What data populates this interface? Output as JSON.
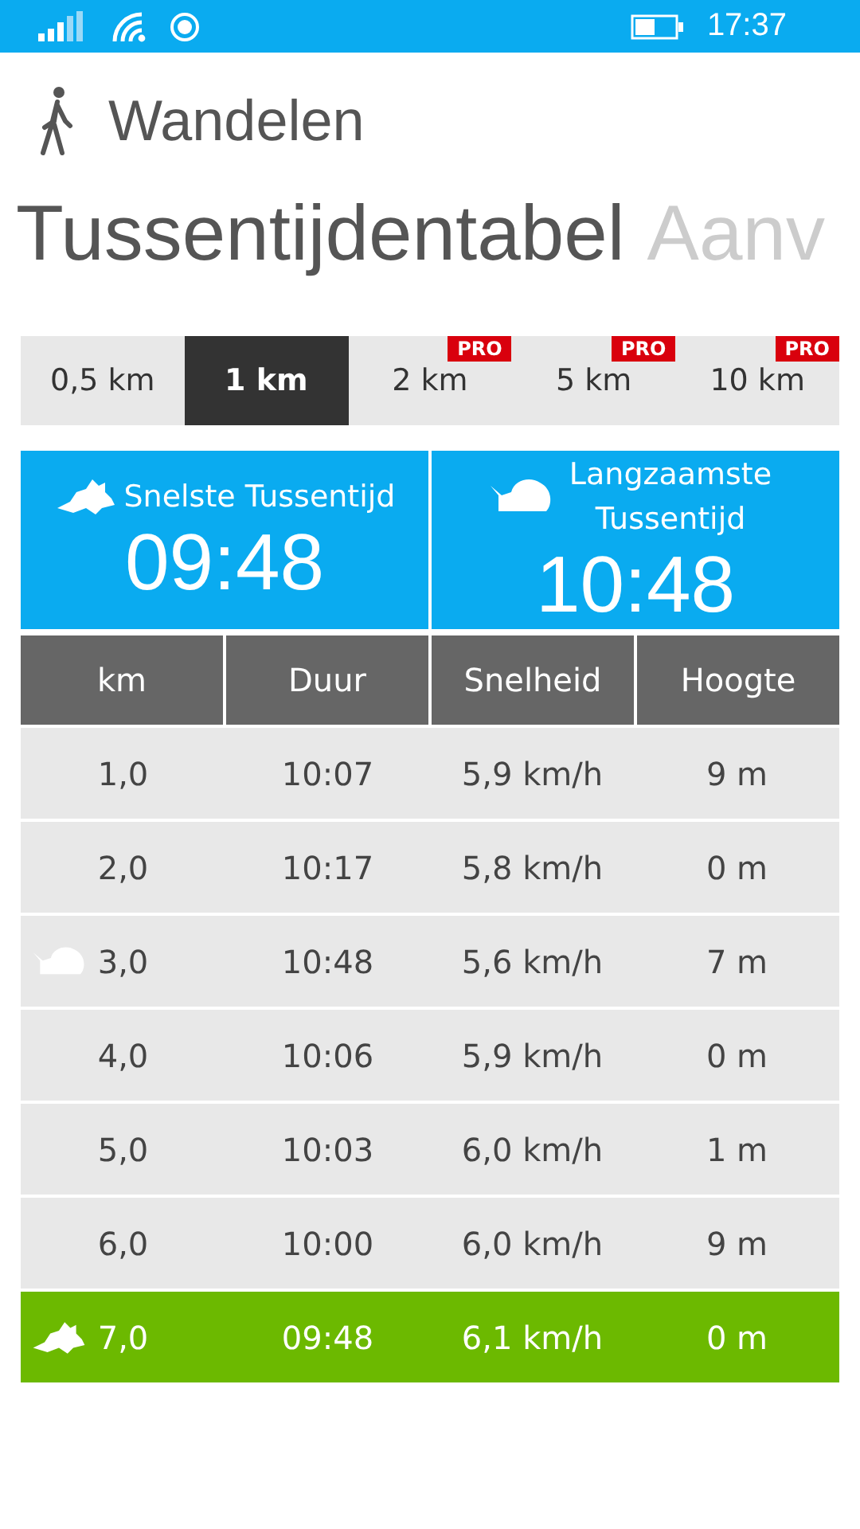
{
  "status_bar": {
    "time": "17:37"
  },
  "app": {
    "title": "Wandelen"
  },
  "pivot": [
    {
      "label": "Tussentijdentabel",
      "selected": true
    },
    {
      "label": "Aanv",
      "selected": false
    }
  ],
  "tabs": [
    {
      "label": "0,5 km",
      "selected": false,
      "pro": false
    },
    {
      "label": "1 km",
      "selected": true,
      "pro": false
    },
    {
      "label": "2 km",
      "selected": false,
      "pro": true,
      "badge": "PRO"
    },
    {
      "label": "5 km",
      "selected": false,
      "pro": true,
      "badge": "PRO"
    },
    {
      "label": "10 km",
      "selected": false,
      "pro": true,
      "badge": "PRO"
    }
  ],
  "summary": [
    {
      "kind": "fastest",
      "label": "Snelste Tussentijd",
      "value": "09:48"
    },
    {
      "kind": "slowest",
      "label": "Langzaamste Tussentijd",
      "value": "10:48"
    }
  ],
  "table": {
    "columns": [
      "km",
      "Duur",
      "Snelheid",
      "Hoogte"
    ],
    "rows": [
      {
        "kind": "normal",
        "cells": [
          "1,0",
          "10:07",
          "5,9 km/h",
          "9 m"
        ]
      },
      {
        "kind": "normal",
        "cells": [
          "2,0",
          "10:17",
          "5,8 km/h",
          "0 m"
        ]
      },
      {
        "kind": "slowest",
        "cells": [
          "3,0",
          "10:48",
          "5,6 km/h",
          "7 m"
        ]
      },
      {
        "kind": "normal",
        "cells": [
          "4,0",
          "10:06",
          "5,9 km/h",
          "0 m"
        ]
      },
      {
        "kind": "normal",
        "cells": [
          "5,0",
          "10:03",
          "6,0 km/h",
          "1 m"
        ]
      },
      {
        "kind": "normal",
        "cells": [
          "6,0",
          "10:00",
          "6,0 km/h",
          "9 m"
        ]
      },
      {
        "kind": "fastest",
        "cells": [
          "7,0",
          "09:48",
          "6,1 km/h",
          "0 m"
        ]
      }
    ]
  }
}
